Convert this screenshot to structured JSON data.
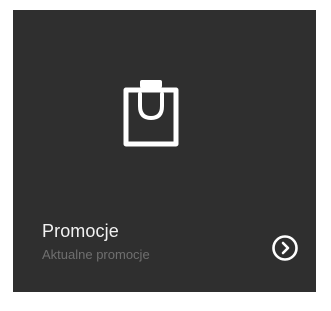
{
  "tile": {
    "title": "Promocje",
    "subtitle": "Aktualne promocje",
    "icon": "shopping-bag-icon",
    "action_icon": "chevron-right-circle-icon"
  },
  "colors": {
    "tile_background": "#2f2f2f",
    "title_text": "#f2f2f2",
    "subtitle_text": "#6f6f6f",
    "icon_stroke": "#ffffff"
  }
}
